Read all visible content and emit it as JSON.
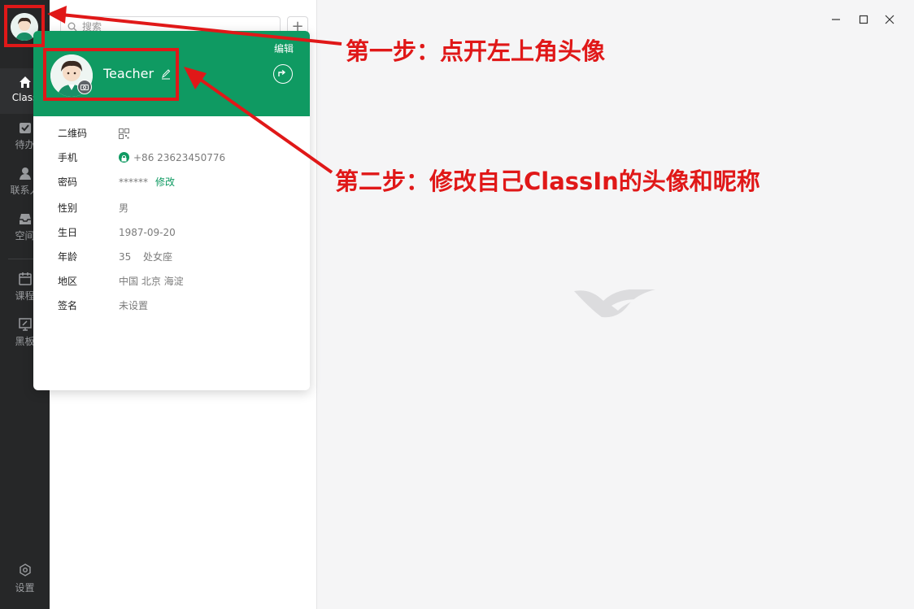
{
  "sidebar": {
    "items": [
      {
        "label": "Class",
        "icon": "home-icon"
      },
      {
        "label": "待办",
        "icon": "todo-check-icon"
      },
      {
        "label": "联系人",
        "icon": "contact-person-icon"
      },
      {
        "label": "空间",
        "icon": "inbox-space-icon"
      },
      {
        "label": "课程",
        "icon": "calendar-course-icon"
      },
      {
        "label": "黑板",
        "icon": "blackboard-icon"
      }
    ],
    "settings_label": "设置"
  },
  "list": {
    "search_placeholder": "搜索",
    "add_label": "+"
  },
  "profile": {
    "edit_label": "编辑",
    "nickname": "Teacher",
    "rows": [
      {
        "key": "二维码",
        "value": ""
      },
      {
        "key": "手机",
        "value": "+86 23623450776"
      },
      {
        "key": "密码",
        "value": "******",
        "link": "修改"
      },
      {
        "key": "性别",
        "value": "男"
      },
      {
        "key": "生日",
        "value": "1987-09-20"
      },
      {
        "key": "年龄",
        "value": "35",
        "extra": "处女座"
      },
      {
        "key": "地区",
        "value": "中国 北京 海淀"
      },
      {
        "key": "签名",
        "value": "未设置"
      }
    ]
  },
  "annotations": {
    "step1": "第一步：点开左上角头像",
    "step2": "第二步：修改自己ClassIn的头像和昵称"
  },
  "colors": {
    "accent_green": "#0f9a62",
    "annotation_red": "#e01818",
    "sidebar_dark": "#262728"
  }
}
